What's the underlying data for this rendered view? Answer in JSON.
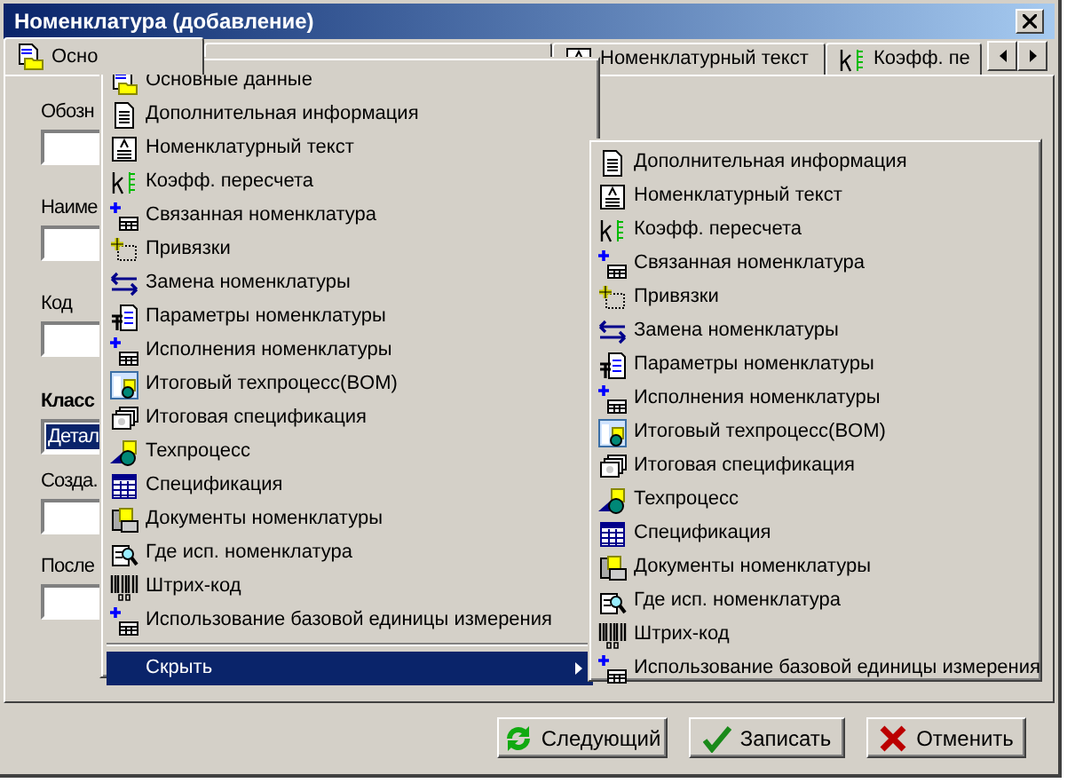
{
  "window": {
    "title": "Номенклатура (добавление)"
  },
  "tabs": [
    {
      "label": "Осно",
      "kind": "main",
      "selected": true
    },
    {
      "selected": false
    },
    {
      "label": "Номенклатурный текст",
      "kind": "text",
      "selected": false
    },
    {
      "label": "Коэфф. пе",
      "kind": "coef",
      "selected": false
    }
  ],
  "fields": [
    {
      "label": "Обозн",
      "kind": "input"
    },
    {
      "label": "Наиме",
      "kind": "input"
    },
    {
      "label": "Код",
      "kind": "input"
    },
    {
      "label": "Класс",
      "kind": "select",
      "bold": true,
      "value": "Детал"
    },
    {
      "label": "Созда.",
      "kind": "input"
    },
    {
      "label": "После",
      "kind": "input"
    }
  ],
  "context_menu": {
    "items": [
      {
        "label": "Основные данные",
        "kind": "main"
      },
      {
        "label": "Дополнительная информация",
        "kind": "doc"
      },
      {
        "label": "Номенклатурный текст",
        "kind": "text"
      },
      {
        "label": "Коэфф. пересчета",
        "kind": "coef"
      },
      {
        "label": "Связанная номенклатура",
        "kind": "plustable"
      },
      {
        "label": "Привязки",
        "kind": "binding"
      },
      {
        "label": "Замена номенклатуры",
        "kind": "swap"
      },
      {
        "label": "Параметры номенклатуры",
        "kind": "params"
      },
      {
        "label": "Исполнения номенклатуры",
        "kind": "plustable"
      },
      {
        "label": "Итоговый техпроцесс(BOM)",
        "kind": "bom"
      },
      {
        "label": "Итоговая спецификация",
        "kind": "stack"
      },
      {
        "label": "Техпроцесс",
        "kind": "process"
      },
      {
        "label": "Спецификация",
        "kind": "grid"
      },
      {
        "label": "Документы номенклатуры",
        "kind": "docs"
      },
      {
        "label": "Где исп. номенклатура",
        "kind": "where"
      },
      {
        "label": "Штрих-код",
        "kind": "barcode"
      },
      {
        "label": "Использование базовой единицы измерения",
        "kind": "plustable"
      }
    ],
    "hide_item": {
      "label": "Скрыть",
      "selected": true,
      "has_submenu": true
    }
  },
  "submenu": {
    "items": [
      {
        "label": "Дополнительная информация",
        "kind": "doc"
      },
      {
        "label": "Номенклатурный текст",
        "kind": "text"
      },
      {
        "label": "Коэфф. пересчета",
        "kind": "coef"
      },
      {
        "label": "Связанная номенклатура",
        "kind": "plustable"
      },
      {
        "label": "Привязки",
        "kind": "binding"
      },
      {
        "label": "Замена номенклатуры",
        "kind": "swap"
      },
      {
        "label": "Параметры номенклатуры",
        "kind": "params"
      },
      {
        "label": "Исполнения номенклатуры",
        "kind": "plustable"
      },
      {
        "label": "Итоговый техпроцесс(BOM)",
        "kind": "bom"
      },
      {
        "label": "Итоговая спецификация",
        "kind": "stack"
      },
      {
        "label": "Техпроцесс",
        "kind": "process"
      },
      {
        "label": "Спецификация",
        "kind": "grid"
      },
      {
        "label": "Документы номенклатуры",
        "kind": "docs"
      },
      {
        "label": "Где исп. номенклатура",
        "kind": "where"
      },
      {
        "label": "Штрих-код",
        "kind": "barcode"
      },
      {
        "label": "Использование базовой единицы измерения",
        "kind": "plustable"
      }
    ]
  },
  "buttons": [
    {
      "label": "Следующий",
      "kind": "refresh"
    },
    {
      "label": "Записать",
      "kind": "check"
    },
    {
      "label": "Отменить",
      "kind": "cross"
    }
  ]
}
